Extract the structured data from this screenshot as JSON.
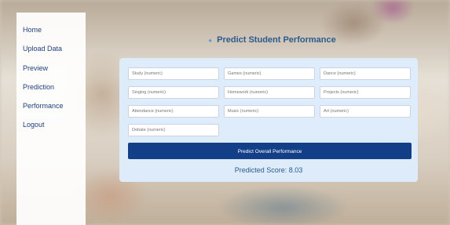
{
  "sidebar": {
    "items": [
      {
        "label": "Home"
      },
      {
        "label": "Upload Data"
      },
      {
        "label": "Preview"
      },
      {
        "label": "Prediction"
      },
      {
        "label": "Performance"
      },
      {
        "label": "Logout"
      }
    ]
  },
  "main": {
    "title": "Predict Student Performance",
    "fields": [
      {
        "placeholder": "Study (numeric)",
        "value": ""
      },
      {
        "placeholder": "Games (numeric)",
        "value": ""
      },
      {
        "placeholder": "Dance (numeric)",
        "value": ""
      },
      {
        "placeholder": "Singing (numeric)",
        "value": ""
      },
      {
        "placeholder": "Homework (numeric)",
        "value": ""
      },
      {
        "placeholder": "Projects (numeric)",
        "value": ""
      },
      {
        "placeholder": "Attendance (numeric)",
        "value": ""
      },
      {
        "placeholder": "Music (numeric)",
        "value": ""
      },
      {
        "placeholder": "Art (numeric)",
        "value": ""
      },
      {
        "placeholder": "Debate (numeric)",
        "value": ""
      }
    ],
    "predict_button": "Predict Overall Performance",
    "result_text": "Predicted Score: 8.03"
  },
  "colors": {
    "accent": "#123f87",
    "title": "#2b5a8f",
    "panel": "#deecfc"
  }
}
